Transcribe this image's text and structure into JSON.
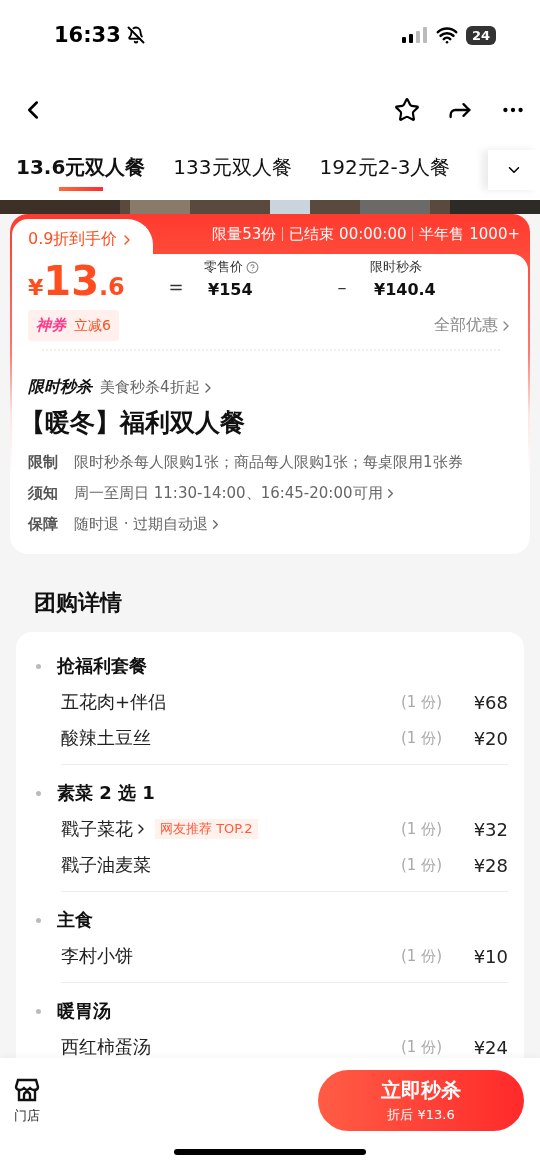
{
  "status_bar": {
    "time": "16:33",
    "battery": "24"
  },
  "tabs": [
    {
      "label": "13.6元双人餐",
      "selected": true
    },
    {
      "label": "133元双人餐",
      "selected": false
    },
    {
      "label": "192元2-3人餐",
      "selected": false
    }
  ],
  "deal": {
    "discount_link": "0.9折到手价",
    "stats": [
      "限量53份",
      "已结束 00:00:00",
      "半年售 1000+"
    ],
    "currency": "¥",
    "price_int": "13",
    "price_dec": ".6",
    "equals": "=",
    "retail_label": "零售价",
    "retail": "¥154",
    "minus": "–",
    "flash_label": "限时秒杀",
    "flash": "¥140.4",
    "coupon_brand": "神券",
    "coupon_text": "立减6",
    "all_offers": "全部优惠"
  },
  "info": {
    "brand": "限时秒杀",
    "promo": "美食秒杀4折起",
    "title": "【暖冬】福利双人餐",
    "rows": [
      {
        "label": "限制",
        "text": "限时秒杀每人限购1张；商品每人限购1张；每桌限用1张券",
        "link": false
      },
      {
        "label": "须知",
        "text": "周一至周日 11:30-14:00、16:45-20:00可用",
        "link": true
      },
      {
        "label": "保障",
        "text": "随时退 · 过期自动退",
        "link": true
      }
    ]
  },
  "details": {
    "title": "团购详情",
    "groups": [
      {
        "name": "抢福利套餐",
        "items": [
          {
            "name": "五花肉+伴侣",
            "qty": "(1 份)",
            "price": "¥68",
            "link": false
          },
          {
            "name": "酸辣土豆丝",
            "qty": "(1 份)",
            "price": "¥20",
            "link": false
          }
        ]
      },
      {
        "name": "素菜 2 选 1",
        "items": [
          {
            "name": "戳子菜花",
            "badge": "网友推荐 TOP.2",
            "qty": "(1 份)",
            "price": "¥32",
            "link": true
          },
          {
            "name": "戳子油麦菜",
            "qty": "(1 份)",
            "price": "¥28",
            "link": false
          }
        ]
      },
      {
        "name": "主食",
        "items": [
          {
            "name": "李村小饼",
            "qty": "(1 份)",
            "price": "¥10",
            "link": false
          }
        ]
      },
      {
        "name": "暖胃汤",
        "items": [
          {
            "name": "西红柿蛋汤",
            "qty": "(1 份)",
            "price": "¥24",
            "link": false
          }
        ]
      }
    ]
  },
  "bottom": {
    "store": "门店",
    "cta": "立即秒杀",
    "cta_sub": "折后 ¥13.6"
  }
}
